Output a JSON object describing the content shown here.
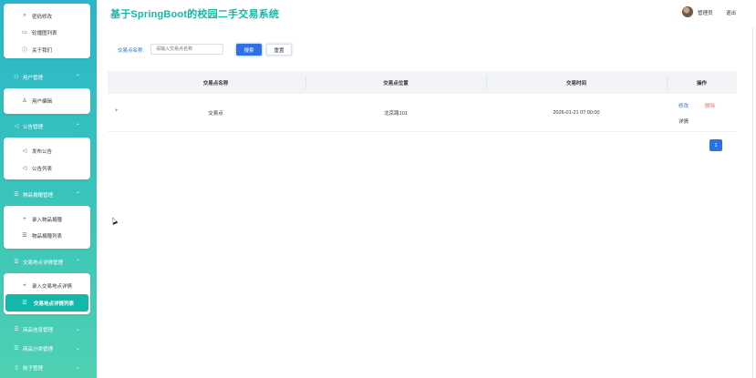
{
  "app": {
    "title": "基于SpringBoot的校园二手交易系统"
  },
  "header": {
    "user_name": "管理员",
    "logout_label": "退出"
  },
  "sidebar": {
    "top_card": [
      {
        "icon": "key-icon",
        "glyph": "⌕",
        "label": "密码修改"
      },
      {
        "icon": "image-icon",
        "glyph": "▭",
        "label": "轮播图列表"
      },
      {
        "icon": "info-icon",
        "glyph": "ⓘ",
        "label": "关于我们"
      }
    ],
    "groups": [
      {
        "name": "user",
        "icon": "users-icon",
        "glyph": "⚇",
        "label": "用户管理",
        "expanded": true,
        "items": [
          {
            "icon": "user-icon",
            "glyph": "♙",
            "label": "用户编辑"
          }
        ]
      },
      {
        "name": "notice",
        "icon": "megaphone-icon",
        "glyph": "◁",
        "label": "公告管理",
        "expanded": true,
        "items": [
          {
            "icon": "megaphone-icon",
            "glyph": "◁",
            "label": "发布公告"
          },
          {
            "icon": "megaphone-icon",
            "glyph": "◁",
            "label": "公告列表"
          }
        ]
      },
      {
        "name": "goods-donate",
        "icon": "list-icon",
        "glyph": "☰",
        "label": "物品捐赠管理",
        "expanded": true,
        "items": [
          {
            "icon": "plus-icon",
            "glyph": "+",
            "label": "录入物品捐赠"
          },
          {
            "icon": "list-icon",
            "glyph": "☰",
            "label": "物品捐赠列表"
          }
        ]
      },
      {
        "name": "trade-place",
        "icon": "list-icon",
        "glyph": "☰",
        "label": "交易地点详情管理",
        "expanded": true,
        "items": [
          {
            "icon": "plus-icon",
            "glyph": "+",
            "label": "录入交易地点详情"
          },
          {
            "icon": "list-icon",
            "glyph": "☰",
            "label": "交易地点详情列表",
            "active": true
          }
        ]
      },
      {
        "name": "goods-info",
        "icon": "list-icon",
        "glyph": "☰",
        "label": "商品信息管理",
        "expanded": false,
        "items": []
      },
      {
        "name": "goods-category",
        "icon": "list-icon",
        "glyph": "☰",
        "label": "商品分类管理",
        "expanded": false,
        "items": []
      },
      {
        "name": "posts",
        "icon": "document-icon",
        "glyph": "▯",
        "label": "帖子管理",
        "expanded": false,
        "items": []
      }
    ]
  },
  "search": {
    "label": "交易点名称:",
    "placeholder": "请输入交易点名称",
    "search_button": "搜索",
    "reset_button": "重置"
  },
  "table": {
    "columns": [
      "交易点名称",
      "交易点位置",
      "交易时间",
      "操作"
    ],
    "rows": [
      {
        "expand": "+",
        "name": "交易点",
        "location": "北京路101",
        "time": "2026-01-21 07:00:00",
        "edit": "修改",
        "delete": "删除",
        "detail": "详情"
      }
    ]
  },
  "pagination": {
    "current_page": "1"
  },
  "colors": {
    "accent": "#14b8a6",
    "primary": "#2f6fe6",
    "danger": "#f56c6c"
  }
}
